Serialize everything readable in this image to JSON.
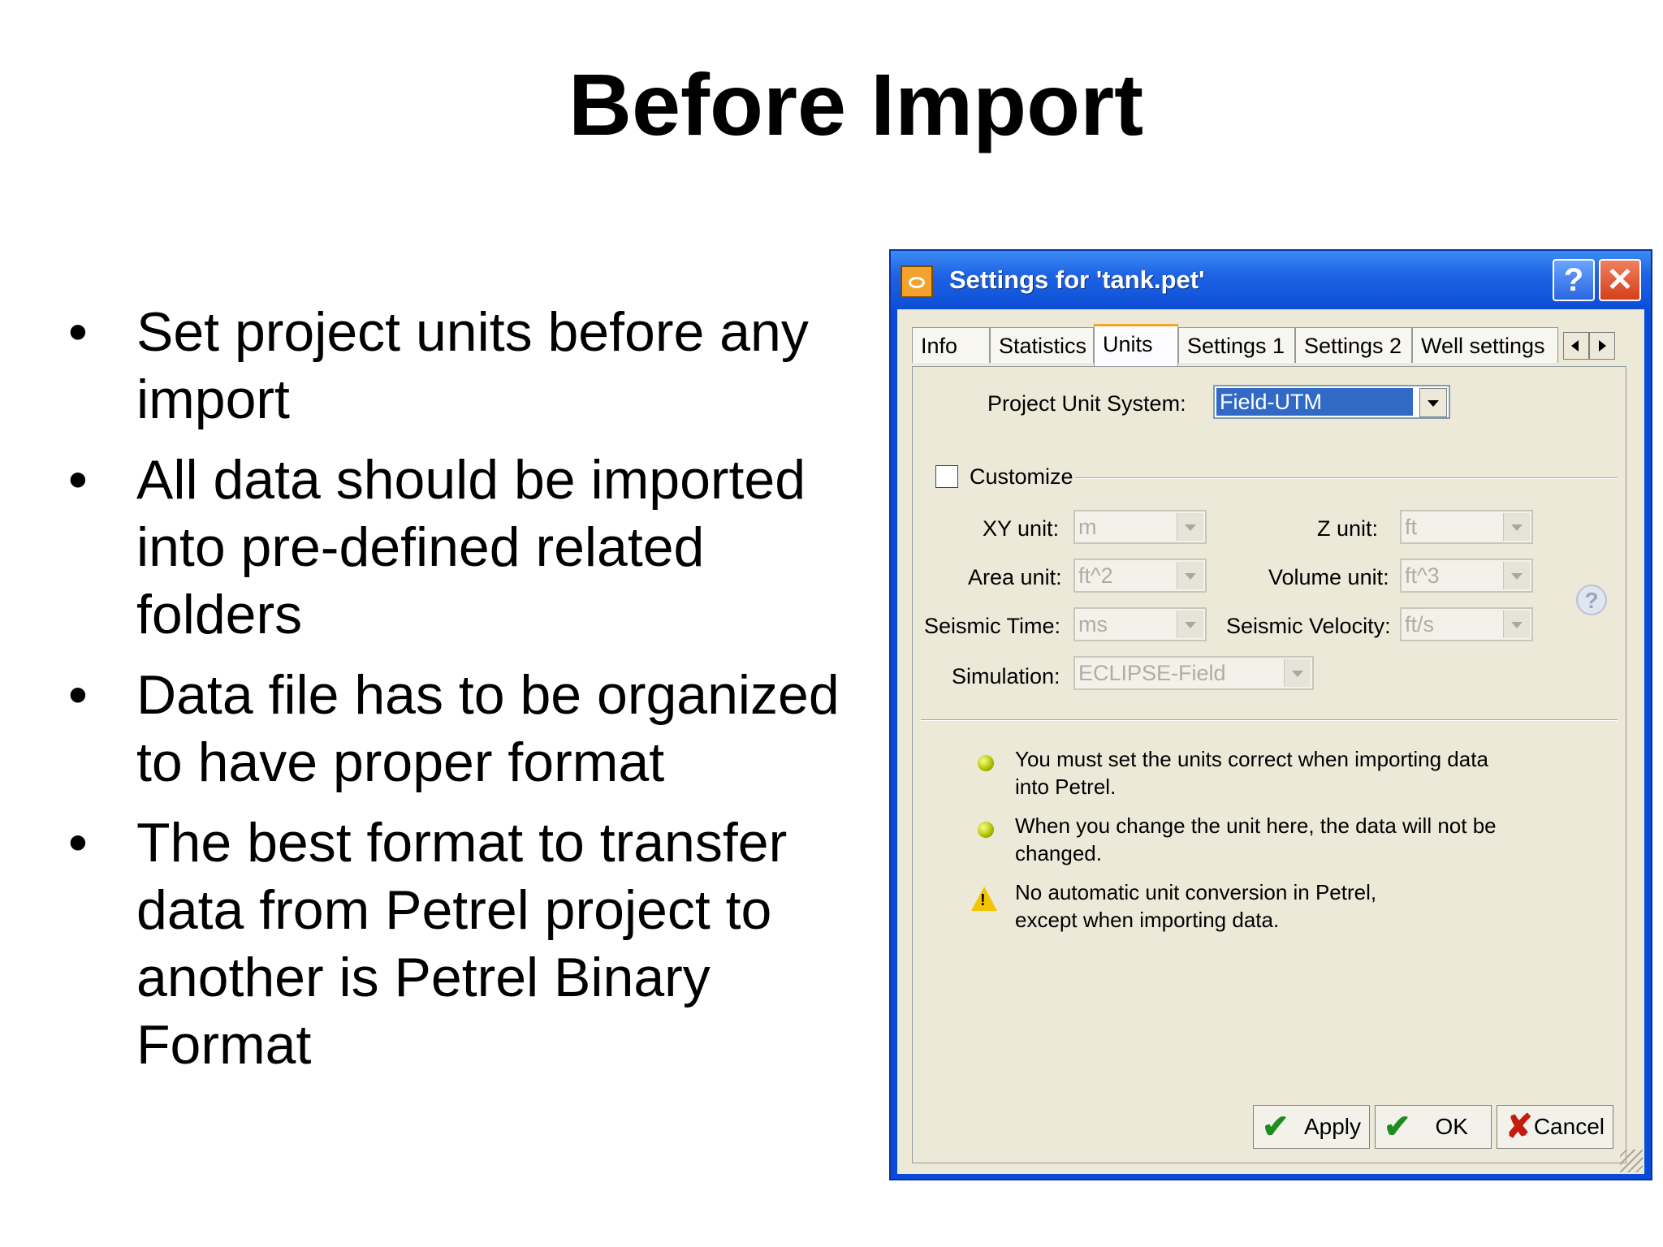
{
  "slide": {
    "title": "Before Import",
    "bullet_char": "•",
    "bullets": [
      "Set project units before any import",
      "All data should be imported into pre-defined related folders",
      "Data file has to be organized to have proper format",
      "The best format to transfer data from Petrel project to another is Petrel Binary Format"
    ]
  },
  "dialog": {
    "title": "Settings for 'tank.pet'",
    "help_label": "?",
    "close_label": "✕",
    "tabs": [
      "Info",
      "Statistics",
      "Units",
      "Settings 1",
      "Settings 2",
      "Well settings"
    ],
    "active_tab": "Units",
    "unit_system": {
      "label": "Project Unit System:",
      "value": "Field-UTM"
    },
    "customize_label": "Customize",
    "units": {
      "xy": {
        "label": "XY unit:",
        "value": "m"
      },
      "z": {
        "label": "Z unit:",
        "value": "ft"
      },
      "area": {
        "label": "Area unit:",
        "value": "ft^2"
      },
      "volume": {
        "label": "Volume unit:",
        "value": "ft^3"
      },
      "seismic_time": {
        "label": "Seismic Time:",
        "value": "ms"
      },
      "seismic_velocity": {
        "label": "Seismic Velocity:",
        "value": "ft/s"
      },
      "simulation": {
        "label": "Simulation:",
        "value": "ECLIPSE-Field"
      }
    },
    "help_circle": "?",
    "messages": [
      {
        "line1": "You must set the units correct when importing data",
        "line2": "into Petrel."
      },
      {
        "line1": "When you change the unit here, the data will not be",
        "line2": "changed."
      },
      {
        "line1": "No automatic unit conversion in Petrel,",
        "line2": "except when importing data."
      }
    ],
    "buttons": {
      "apply": "Apply",
      "ok": "OK",
      "cancel": "Cancel"
    },
    "icons": {
      "check": "✔",
      "cross": "✘",
      "warning_mark": "!"
    },
    "colors": {
      "titlebar": "#0a4cd9",
      "selection": "#316ac5",
      "face": "#ece9d8"
    }
  }
}
